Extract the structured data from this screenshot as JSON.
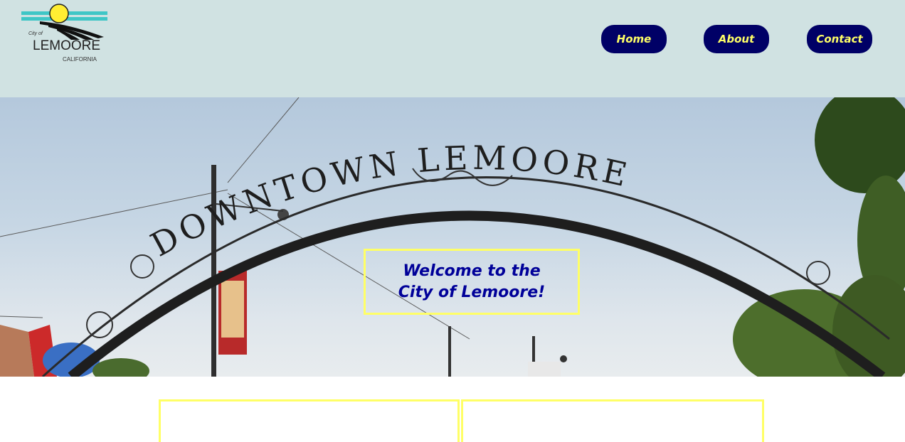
{
  "header": {
    "logo": {
      "city_of": "City of",
      "name": "LEMOORE",
      "state": "CALIFORNIA"
    },
    "nav": [
      {
        "label": "Home"
      },
      {
        "label": "About"
      },
      {
        "label": "Contact"
      }
    ]
  },
  "hero": {
    "arch_text": "DOWNTOWN LEMOORE",
    "welcome": "Welcome to the City of Lemoore!"
  },
  "colors": {
    "header_bg": "#d0e2e2",
    "nav_bg": "#000066",
    "nav_text": "#ffff66",
    "welcome_text": "#000099",
    "accent_border": "#ffff66"
  }
}
